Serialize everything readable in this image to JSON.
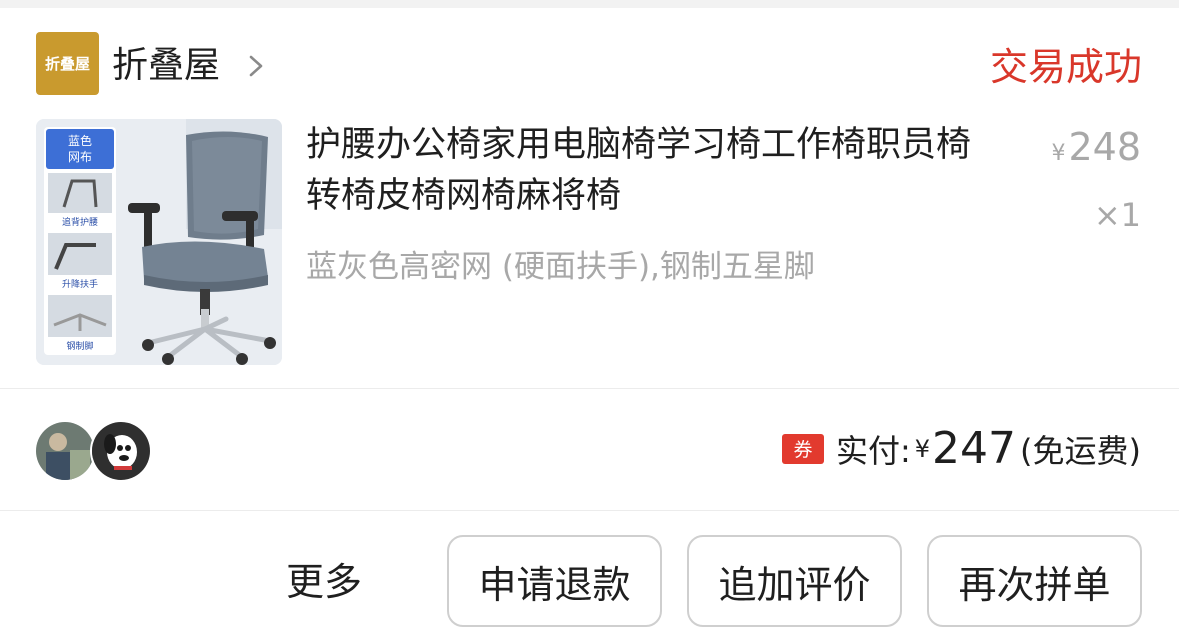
{
  "shop": {
    "logo_text": "折叠屋",
    "name": "折叠屋",
    "chevron_icon": "chevron-right-icon"
  },
  "order": {
    "status": "交易成功",
    "status_color": "#d9372a"
  },
  "product": {
    "title": "护腰办公椅家用电脑椅学习椅工作椅职员椅转椅皮椅网椅麻将椅",
    "spec": "蓝灰色高密网 (硬面扶手),钢制五星脚",
    "currency": "¥",
    "price": "248",
    "quantity": "×1",
    "thumb_labels": {
      "color_tag": "蓝色网布",
      "feature_1": "追背护腰",
      "feature_2": "升降扶手",
      "feature_3": "钢制脚"
    }
  },
  "payment": {
    "coupon_badge": "券",
    "label": "实付:",
    "currency": "¥",
    "amount": "247",
    "note": "(免运费)"
  },
  "actions": {
    "more": "更多",
    "refund": "申请退款",
    "add_review": "追加评价",
    "reorder": "再次拼单"
  },
  "colors": {
    "accent_red": "#e23a2e",
    "logo_gold": "#c99a2e",
    "muted_gray": "#a8a8a8"
  }
}
